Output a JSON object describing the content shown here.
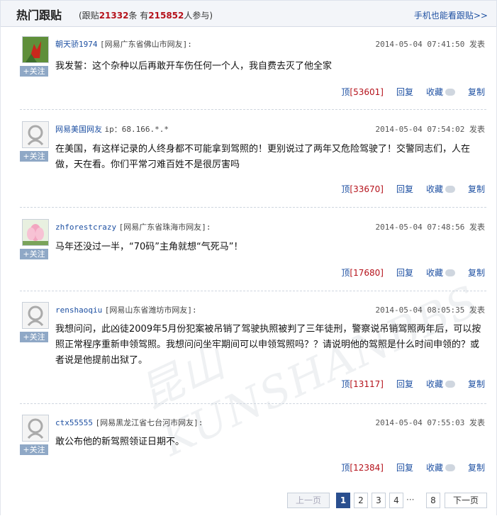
{
  "header": {
    "title": "热门跟贴",
    "stats_pre": "(跟贴",
    "comment_count": "21332",
    "stats_mid": "条 有",
    "participant_count": "215852",
    "stats_post": "人参与)",
    "mobile_link": "手机也能看跟贴>>"
  },
  "follow_label": "+关注",
  "posts": [
    {
      "user": "朝天骄1974",
      "location": "[网易广东省佛山市网友]:",
      "time": "2014-05-04 07:41:50 发表",
      "content": "我发誓：这个杂种以后再敢开车伤任何一个人，我自费去灭了他全家",
      "up_label": "顶",
      "up_count": "[53601]",
      "reply": "回复",
      "fav": "收藏",
      "copy": "复制"
    },
    {
      "user": "网易美国网友",
      "location": "ip：68.166.*.*",
      "time": "2014-05-04 07:54:02 发表",
      "content": "在美国，有这样记录的人终身都不可能拿到驾照的！更别说过了两年又危险驾驶了！交警同志们，人在做，天在看。你们平常刁难百姓不是很厉害吗",
      "up_label": "顶",
      "up_count": "[33670]",
      "reply": "回复",
      "fav": "收藏",
      "copy": "复制"
    },
    {
      "user": "zhforestcrazy",
      "location": "[网易广东省珠海市网友]:",
      "time": "2014-05-04 07:48:56 发表",
      "content": "马年还没过一半，“70码”主角就想“气死马”！",
      "up_label": "顶",
      "up_count": "[17680]",
      "reply": "回复",
      "fav": "收藏",
      "copy": "复制"
    },
    {
      "user": "renshaoqiu",
      "location": "[网易山东省潍坊市网友]:",
      "time": "2014-05-04 08:05:35 发表",
      "content": "我想问问，此凶徒2009年5月份犯案被吊销了驾驶执照被判了三年徒刑，警察说吊销驾照两年后，可以按照正常程序重新申领驾照。我想问问坐牢期间可以申领驾照吗？？请说明他的驾照是什么时间申领的？或者说是他提前出狱了。",
      "up_label": "顶",
      "up_count": "[13117]",
      "reply": "回复",
      "fav": "收藏",
      "copy": "复制"
    },
    {
      "user": "ctx55555",
      "location": "[网易黑龙江省七台河市网友]:",
      "time": "2014-05-04 07:55:03 发表",
      "content": "敢公布他的新驾照领证日期不。",
      "up_label": "顶",
      "up_count": "[12384]",
      "reply": "回复",
      "fav": "收藏",
      "copy": "复制"
    }
  ],
  "pagination": {
    "prev": "上一页",
    "p1": "1",
    "p2": "2",
    "p3": "3",
    "p4": "4",
    "ellipsis": "···",
    "p8": "8",
    "next": "下一页"
  },
  "watermark": "昆山KUNSHANBBS"
}
